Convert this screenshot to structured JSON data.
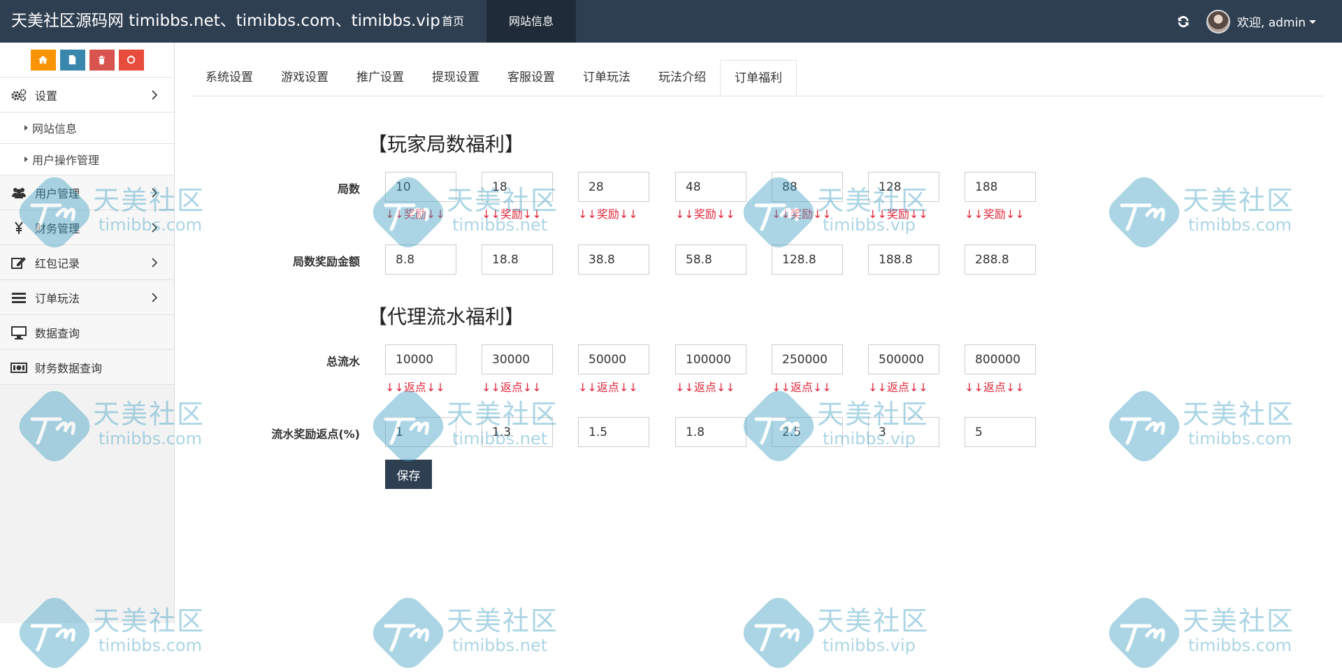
{
  "header": {
    "brand": "天美社区源码网 timibbs.net、timibbs.com、timibbs.vip",
    "nav": [
      {
        "label": "首页",
        "active": false
      },
      {
        "label": "网站信息",
        "active": true
      }
    ],
    "welcome": "欢迎, admin"
  },
  "sidebar": {
    "shortcut_colors": [
      "#f89406",
      "#3a87ad",
      "#d9534f",
      "#e74c3c"
    ],
    "menu_settings": "设置",
    "sub_items": [
      "网站信息",
      "用户操作管理"
    ],
    "menu": [
      "用户管理",
      "财务管理",
      "红包记录",
      "订单玩法",
      "数据查询",
      "财务数据查询"
    ]
  },
  "tabs": [
    "系统设置",
    "游戏设置",
    "推广设置",
    "提现设置",
    "客服设置",
    "订单玩法",
    "玩法介绍",
    "订单福利"
  ],
  "active_tab": "订单福利",
  "player_section": {
    "title": "【玩家局数福利】",
    "rounds_label": "局数",
    "rounds": [
      "10",
      "18",
      "28",
      "48",
      "88",
      "128",
      "188"
    ],
    "hint": "↓↓奖励↓↓",
    "reward_label": "局数奖励金额",
    "rewards": [
      "8.8",
      "18.8",
      "38.8",
      "58.8",
      "128.8",
      "188.8",
      "288.8"
    ]
  },
  "agent_section": {
    "title": "【代理流水福利】",
    "flow_label": "总流水",
    "flows": [
      "10000",
      "30000",
      "50000",
      "100000",
      "250000",
      "500000",
      "800000"
    ],
    "hint": "↓↓返点↓↓",
    "rebate_label": "流水奖励返点(%)",
    "rebates": [
      "1",
      "1.3",
      "1.5",
      "1.8",
      "2.5",
      "3",
      "5"
    ]
  },
  "save_label": "保存",
  "watermark": {
    "cn": "天美社区",
    "domains": [
      "timibbs.com",
      "timibbs.net",
      "timibbs.vip"
    ]
  }
}
